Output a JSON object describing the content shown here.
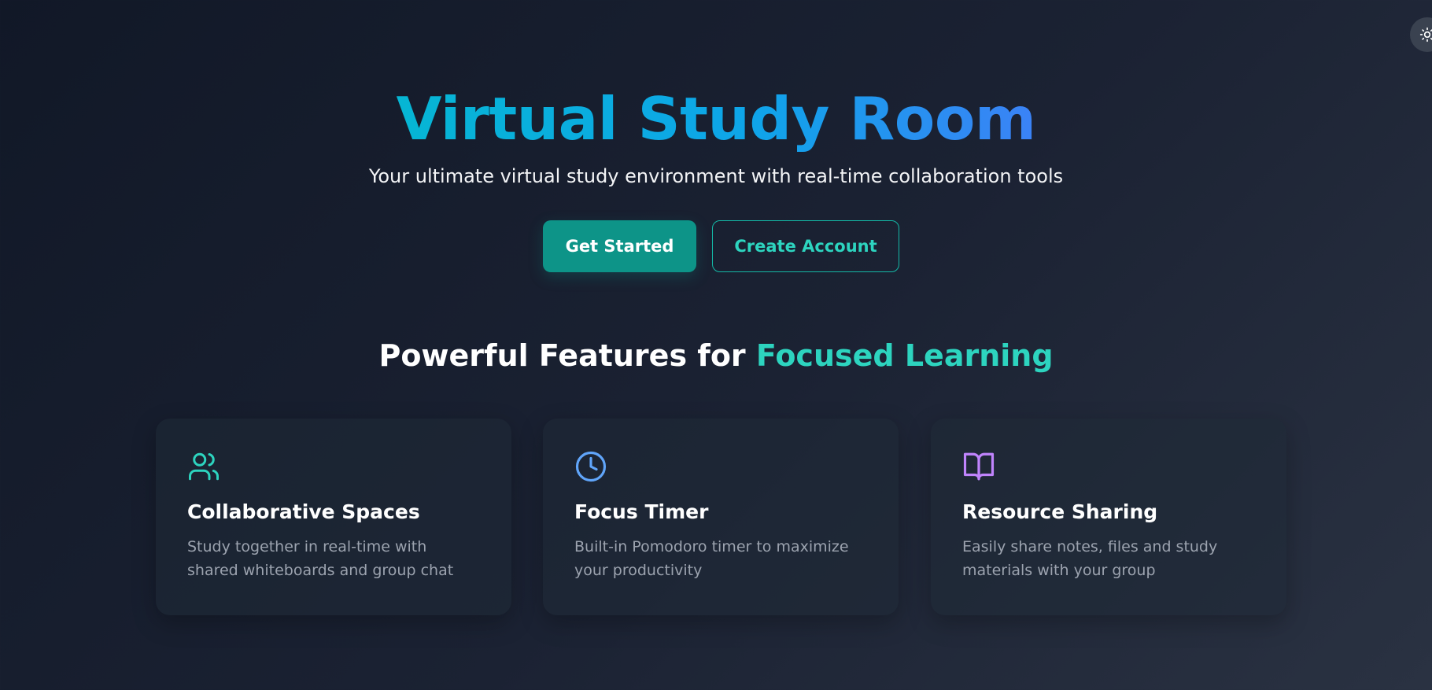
{
  "theme_toggle": {
    "icon": "sun-icon"
  },
  "hero": {
    "title": "Virtual Study Room",
    "subtitle": "Your ultimate virtual study environment with real-time collaboration tools",
    "primary_button": "Get Started",
    "secondary_button": "Create Account"
  },
  "features": {
    "heading_prefix": "Powerful Features for ",
    "heading_accent": "Focused Learning",
    "cards": [
      {
        "icon": "users-icon",
        "title": "Collaborative Spaces",
        "description": "Study together in real-time with shared whiteboards and group chat"
      },
      {
        "icon": "clock-icon",
        "title": "Focus Timer",
        "description": "Built-in Pomodoro timer to maximize your productivity"
      },
      {
        "icon": "book-icon",
        "title": "Resource Sharing",
        "description": "Easily share notes, files and study materials with your group"
      }
    ]
  },
  "colors": {
    "accent_teal": "#2dd4bf",
    "primary_button": "#0d9488",
    "title_gradient_start": "#06b6d4",
    "title_gradient_end": "#3b82f6",
    "clock_icon": "#60a5fa",
    "book_icon": "#c084fc"
  }
}
